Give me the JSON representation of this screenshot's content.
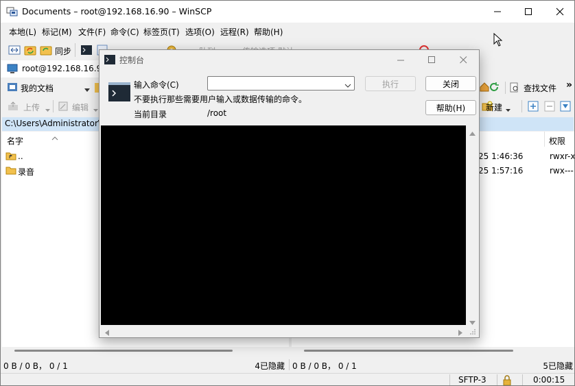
{
  "window": {
    "title": "Documents – root@192.168.16.90 – WinSCP"
  },
  "menu": [
    "本地(L)",
    "标记(M)",
    "文件(F)",
    "命令(C)",
    "标签页(T)",
    "选项(O)",
    "远程(R)",
    "帮助(H)"
  ],
  "toolbar": {
    "sync_label": "同步",
    "queue_label": "队列",
    "transfer_label": "传输选项 默认"
  },
  "tab": {
    "label": "root@192.168.16.90"
  },
  "left_panel": {
    "location": "我的文档",
    "upload_label": "上传",
    "edit_label": "编辑",
    "path": "C:\\Users\\Administrator\\",
    "columns": {
      "name": "名字"
    },
    "files": [
      {
        "name": "..",
        "icon": "parent-folder-icon"
      },
      {
        "name": "录音",
        "icon": "folder-icon"
      }
    ],
    "status_left": "0 B / 0 B， 0 / 1",
    "status_hidden": "4已隐藏"
  },
  "right_panel": {
    "find_label": "查找文件",
    "new_label": "新建",
    "columns": {
      "perm": "权限"
    },
    "rows": [
      {
        "date": "25 1:46:36",
        "perm": "rwxr-x"
      },
      {
        "date": "25 1:57:16",
        "perm": "rwx---"
      }
    ],
    "status_left": "0 B / 0 B， 0 / 1",
    "status_hidden": "5已隐藏"
  },
  "bottom": {
    "protocol": "SFTP-3",
    "elapsed": "0:00:15"
  },
  "dialog": {
    "title": "控制台",
    "input_label": "输入命令(C)",
    "input_value": "",
    "warning": "不要执行那些需要用户输入或数据传输的命令。",
    "dir_label": "当前目录",
    "dir_value": "/root",
    "execute_label": "执行",
    "close_label": "关闭",
    "help_label": "帮助(H)"
  },
  "colors": {
    "path_bg": "#cfe4f7",
    "console_bg": "#000000",
    "accent": "#0078d7"
  }
}
